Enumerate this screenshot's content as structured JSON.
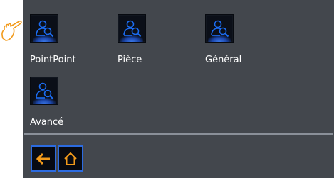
{
  "menu": {
    "items": [
      {
        "label": "PointPoint",
        "icon": "person-search-icon"
      },
      {
        "label": "Pièce",
        "icon": "person-search-icon"
      },
      {
        "label": "Général",
        "icon": "person-search-icon"
      },
      {
        "label": "Avancé",
        "icon": "person-search-icon"
      }
    ]
  },
  "nav": {
    "back_icon": "arrow-left-icon",
    "home_icon": "home-icon"
  },
  "pointer": "pointing-hand-icon",
  "colors": {
    "background": "#43474d",
    "tile": "#0b0f18",
    "icon_outline": "#1b6cf2",
    "accent_orange": "#f29a1b",
    "nav_border": "#2c6be0",
    "text": "#ffffff"
  }
}
